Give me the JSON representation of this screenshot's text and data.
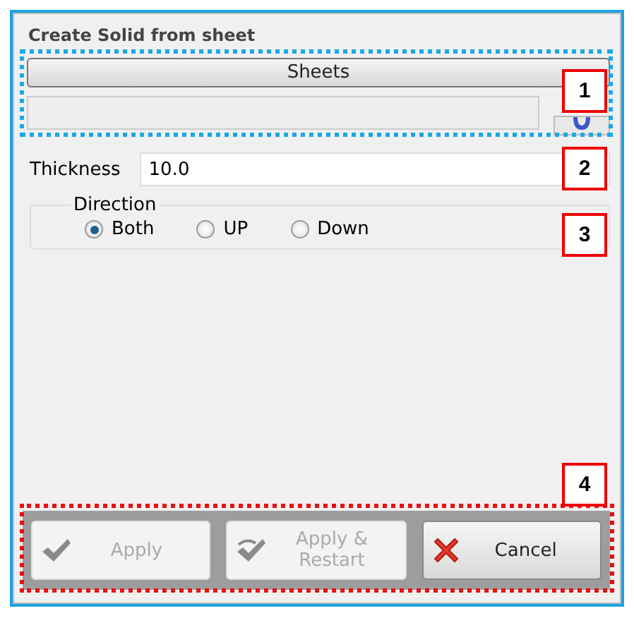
{
  "window": {
    "title": "Create Solid from sheet"
  },
  "sheets": {
    "button": "Sheets"
  },
  "thickness": {
    "label": "Thickness",
    "value": "10.0"
  },
  "direction": {
    "title": "Direction",
    "options": [
      {
        "label": "Both",
        "selected": true
      },
      {
        "label": "UP",
        "selected": false
      },
      {
        "label": "Down",
        "selected": false
      }
    ]
  },
  "buttons": [
    {
      "label": "Apply",
      "kind": "apply",
      "disabled": true
    },
    {
      "label": "Apply & Restart",
      "kind": "restart",
      "disabled": true
    },
    {
      "label": "Cancel",
      "kind": "cancel",
      "disabled": false
    }
  ],
  "callouts": [
    {
      "label": "1"
    },
    {
      "label": "2"
    },
    {
      "label": "3"
    },
    {
      "label": "4"
    }
  ]
}
